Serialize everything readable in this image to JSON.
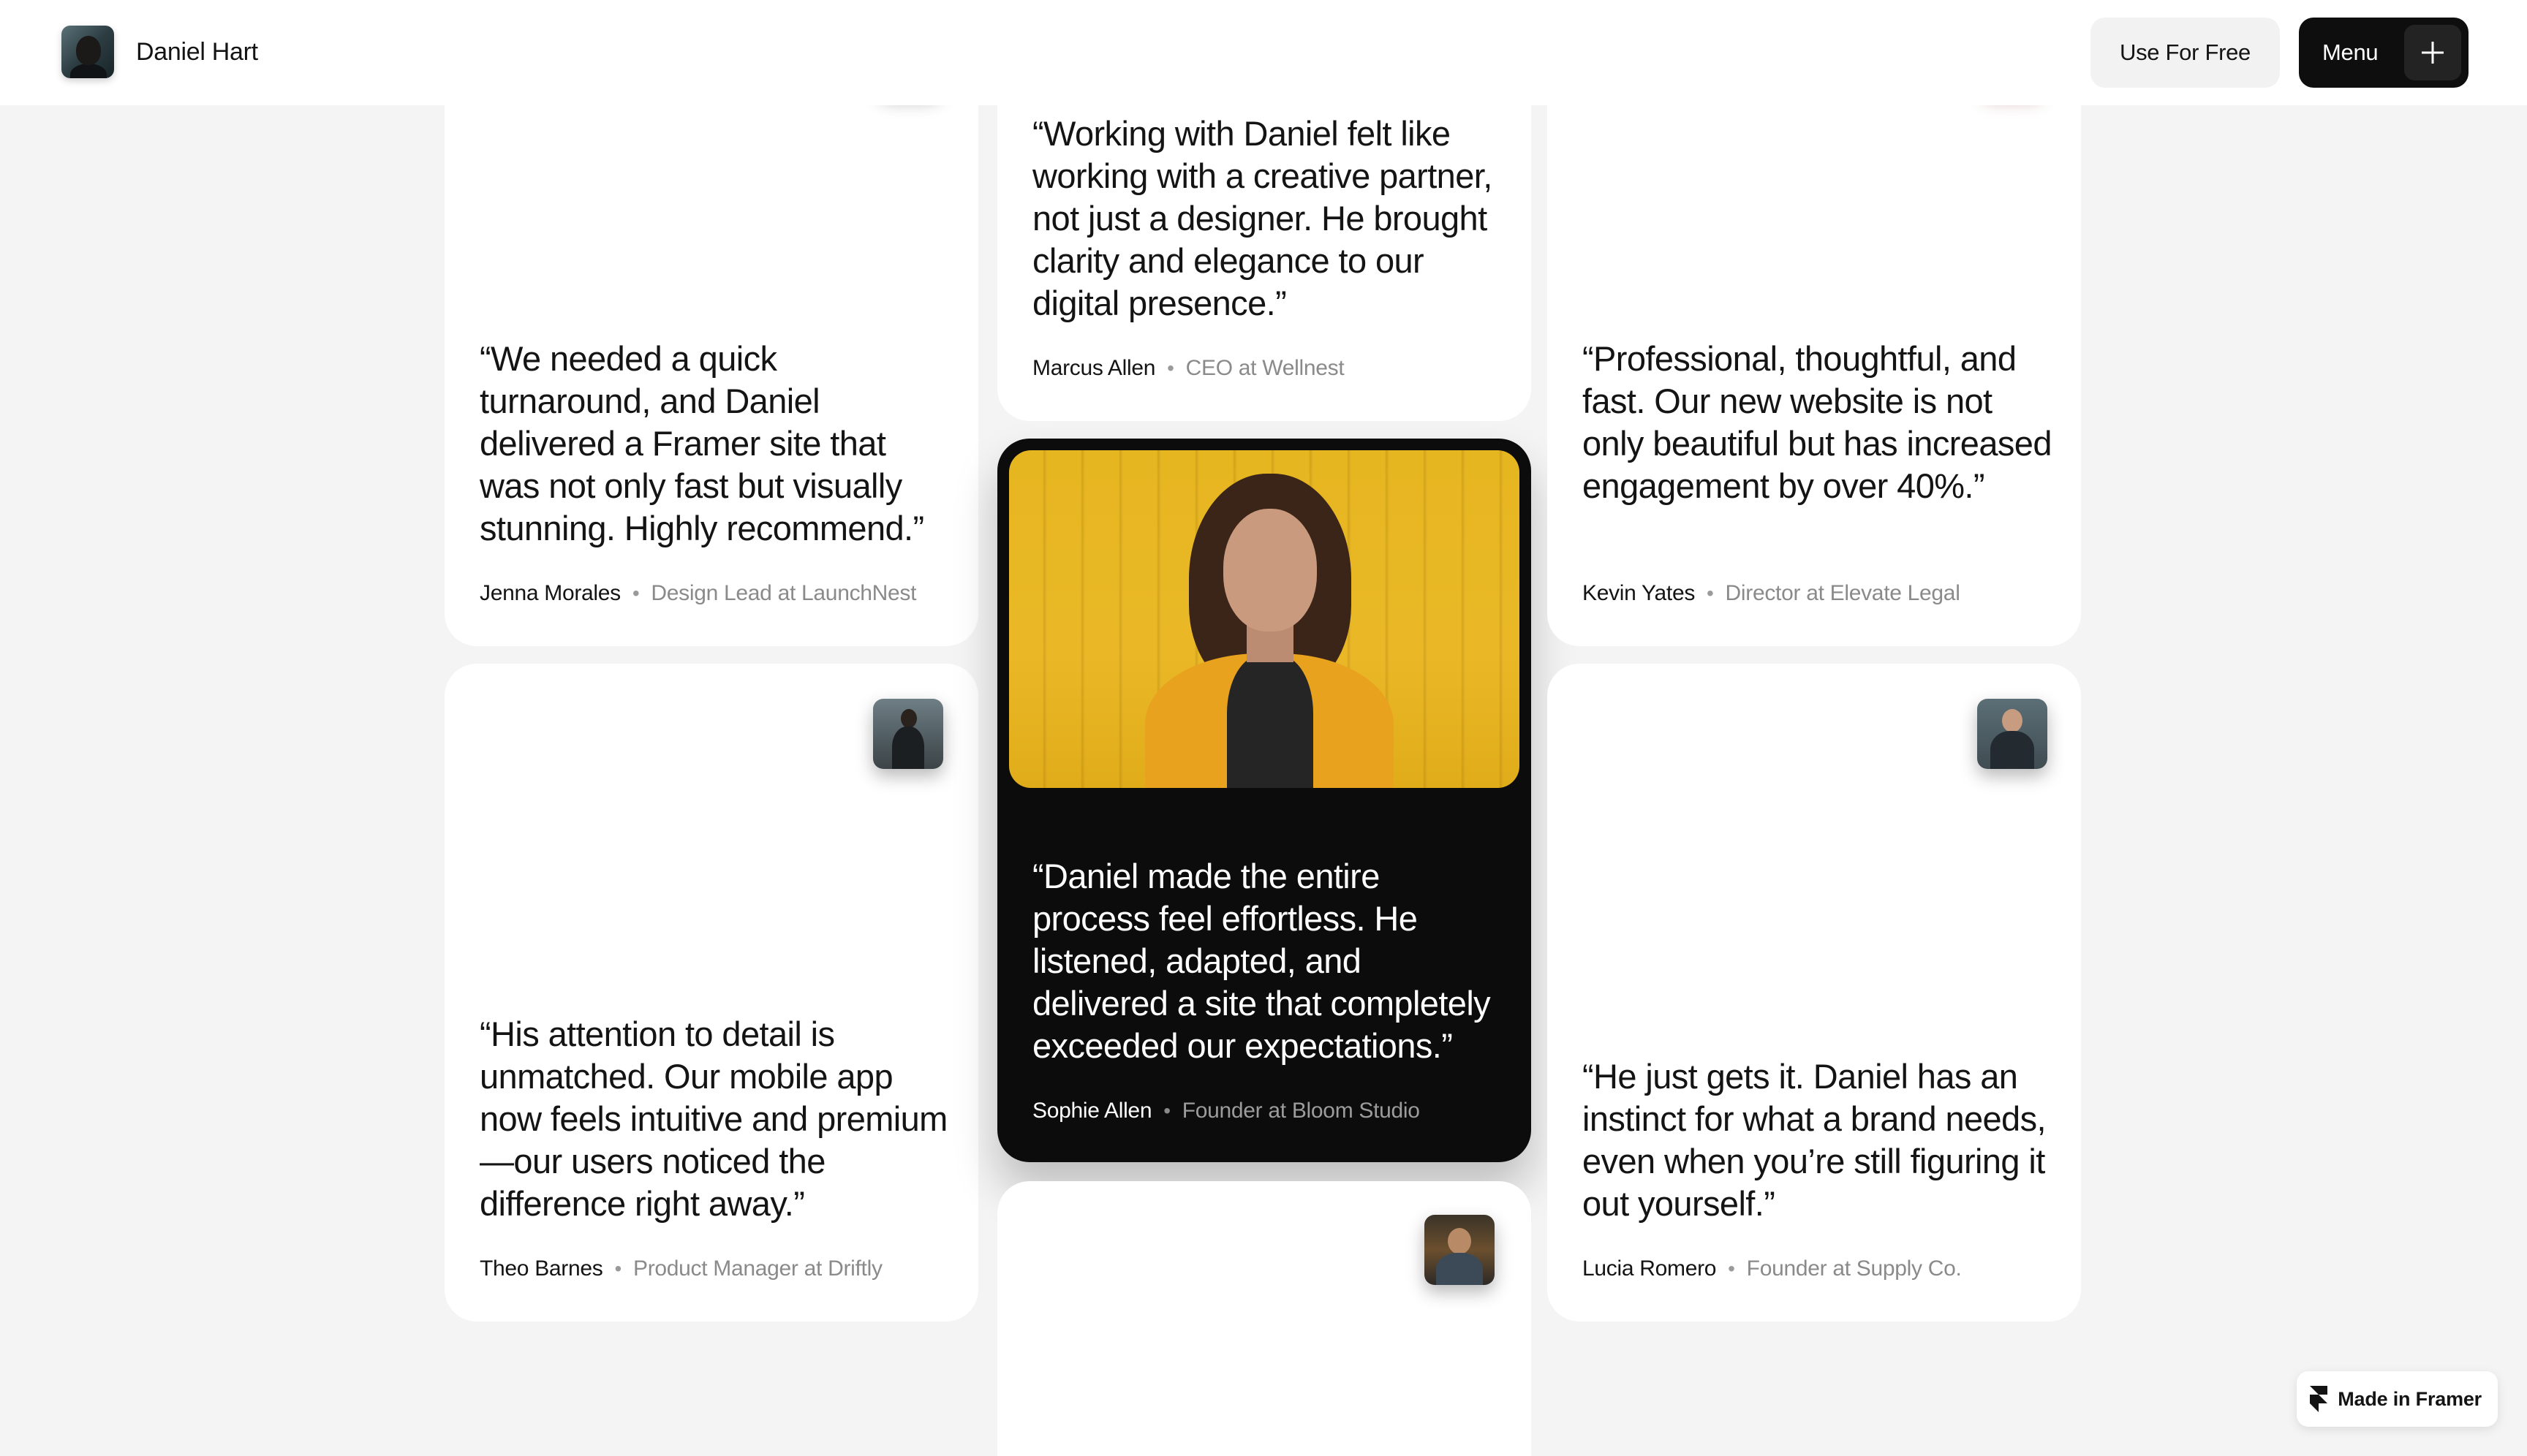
{
  "header": {
    "brand_name": "Daniel Hart",
    "use_free_label": "Use For Free",
    "menu_label": "Menu"
  },
  "testimonials": [
    {
      "quote": "“We needed a quick turnaround, and Daniel delivered a Framer site that was not only fast but visually stunning. Highly recommend.”",
      "name": "Jenna Morales",
      "role": "Design Lead at LaunchNest"
    },
    {
      "quote": "“Working with Daniel felt like working with a creative partner, not just a designer. He brought clarity and elegance to our digital presence.”",
      "name": "Marcus Allen",
      "role": "CEO at Wellnest"
    },
    {
      "quote": "“Professional, thoughtful, and fast. Our new website is not only beautiful but has increased engagement by over 40%.”",
      "name": "Kevin Yates",
      "role": "Director at Elevate Legal"
    },
    {
      "quote": "“His attention to detail is unmatched. Our mobile app now feels intuitive and premium—our users noticed the difference right away.”",
      "name": "Theo Barnes",
      "role": "Product Manager at Driftly"
    },
    {
      "quote": "“Daniel made the entire process feel effortless. He listened, adapted, and delivered a site that completely exceeded our expectations.”",
      "name": "Sophie Allen",
      "role": "Founder at Bloom Studio"
    },
    {
      "quote": "“He just gets it. Daniel has an instinct for what a brand needs, even when you’re still figuring it out yourself.”",
      "name": "Lucia Romero",
      "role": "Founder at Supply Co."
    }
  ],
  "separator": "•",
  "badge": {
    "label": "Made in Framer"
  },
  "icons": {
    "menu_toggle": "plus-icon",
    "badge_logo": "framer-logo-icon"
  },
  "colors": {
    "background": "#f4f4f4",
    "card": "#ffffff",
    "featured_card": "#0c0c0c",
    "accent_yellow": "#e6b620",
    "muted_text": "#8a8a8a"
  }
}
